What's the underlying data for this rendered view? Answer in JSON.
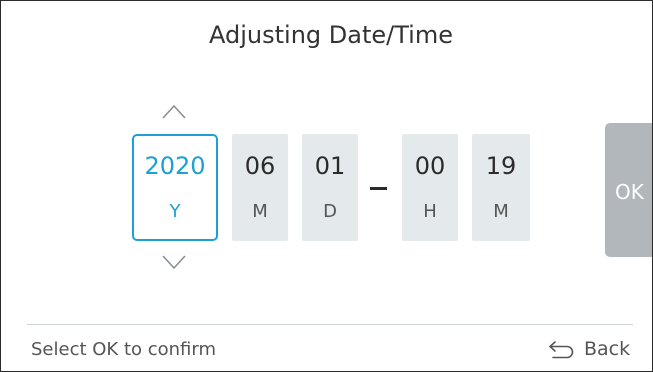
{
  "header": {
    "title": "Adjusting Date/Time"
  },
  "datetime": {
    "selected_field": "year",
    "fields": [
      {
        "key": "year",
        "value": "2020",
        "unit": "Y"
      },
      {
        "key": "month",
        "value": "06",
        "unit": "M"
      },
      {
        "key": "day",
        "value": "01",
        "unit": "D"
      },
      {
        "key": "hour",
        "value": "00",
        "unit": "H"
      },
      {
        "key": "minute",
        "value": "19",
        "unit": "M"
      }
    ],
    "separator": "–"
  },
  "actions": {
    "ok_label": "OK",
    "back_label": "Back"
  },
  "footer": {
    "hint": "Select OK to confirm"
  },
  "icons": {
    "increment": "chevron-up-icon",
    "decrement": "chevron-down-icon",
    "back": "back-arrow-icon"
  },
  "colors": {
    "accent": "#1ea0d2",
    "field_bg": "#e4e9ec",
    "ok_bg": "#b1b7bb",
    "text": "#2b2b2b",
    "muted_text": "#555555"
  }
}
